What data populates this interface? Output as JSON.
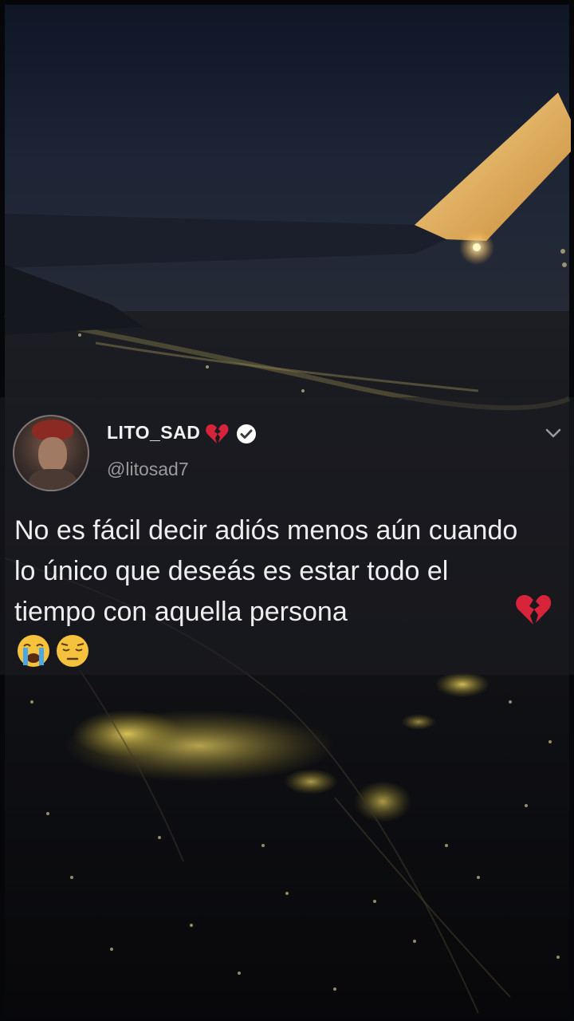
{
  "post": {
    "display_name": "LITO_SAD",
    "handle": "@litosad7",
    "text": "No es fácil decir adiós menos aún cuando lo único que deseás es estar todo el tiempo con aquella persona",
    "icons": [
      "broken-heart-icon",
      "verified-badge-icon",
      "chevron-down-icon",
      "crying-face-icon",
      "pensive-face-icon"
    ]
  },
  "colors": {
    "verified_badge": "#ffffff",
    "broken_heart": "#d8243a",
    "name_text": "#f1f1f1",
    "handle_text": "#9a9a9a"
  }
}
